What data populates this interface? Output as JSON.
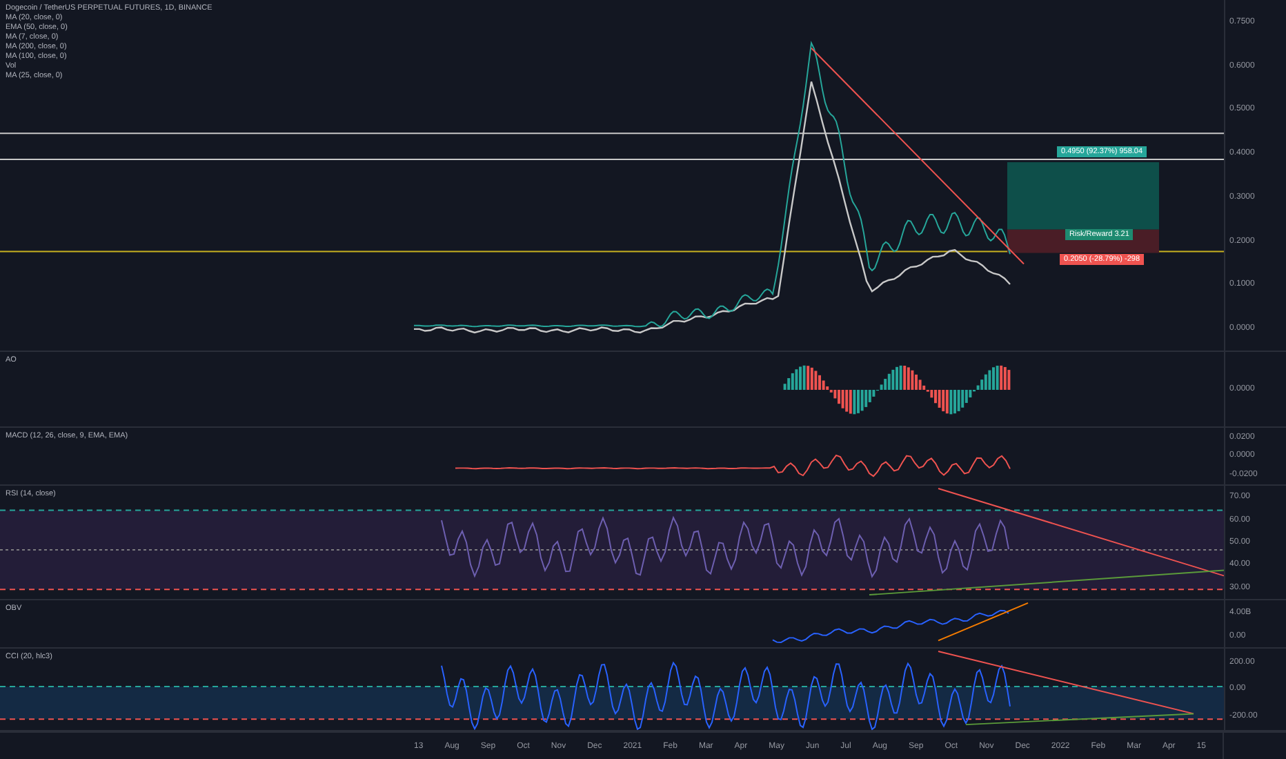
{
  "symbol_title": "Dogecoin / TetherUS PERPETUAL FUTURES, 1D, BINANCE",
  "indicators": [
    "MA (20, close, 0)",
    "EMA (50, close, 0)",
    "MA (7, close, 0)",
    "MA (200, close, 0)",
    "MA (100, close, 0)",
    "Vol",
    "MA (25, close, 0)"
  ],
  "position": {
    "target_label": "0.4950 (92.37%) 958.04",
    "ratio_label": "Risk/Reward 3.21",
    "stop_label": "0.2050 (-28.79%) -298"
  },
  "panes": [
    {
      "kind": "price",
      "axis": [
        "0.7500",
        "0.6000",
        "0.5000",
        "0.4000",
        "0.3000",
        "0.2000",
        "0.1000",
        "0.0000"
      ]
    },
    {
      "kind": "ao",
      "title": "AO",
      "axis": [
        "0.0000"
      ]
    },
    {
      "kind": "macd",
      "title": "MACD (12, 26, close, 9, EMA, EMA)",
      "axis": [
        "0.0200",
        "0.0000",
        "-0.0200"
      ]
    },
    {
      "kind": "rsi",
      "title": "RSI (14, close)",
      "axis": [
        "70.00",
        "60.00",
        "50.00",
        "40.00",
        "30.00"
      ]
    },
    {
      "kind": "obv",
      "title": "OBV",
      "axis": [
        "4.00B",
        "0.00"
      ]
    },
    {
      "kind": "cci",
      "title": "CCI (20, hlc3)",
      "axis": [
        "200.00",
        "0.00",
        "-200.00"
      ]
    }
  ],
  "time_axis": [
    "13",
    "Aug",
    "Sep",
    "Oct",
    "Nov",
    "Dec",
    "2021",
    "Feb",
    "Mar",
    "Apr",
    "May",
    "Jun",
    "Jul",
    "Aug",
    "Sep",
    "Oct",
    "Nov",
    "Dec",
    "2022",
    "Feb",
    "Mar",
    "Apr",
    "15"
  ]
}
